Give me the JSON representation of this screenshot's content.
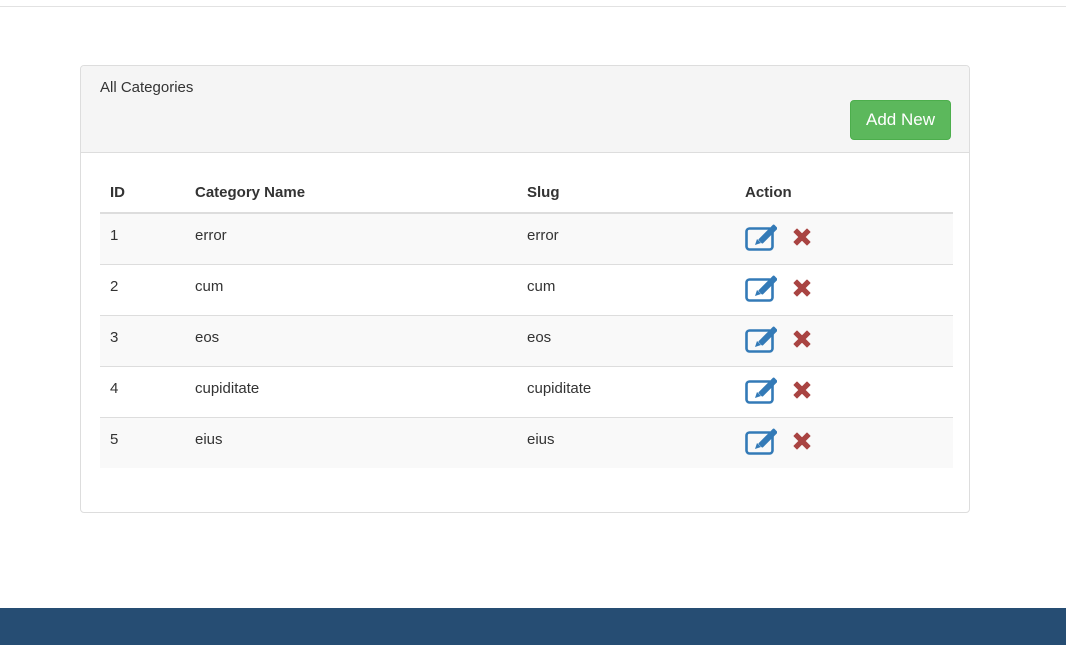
{
  "panel": {
    "title": "All Categories",
    "add_button_label": "Add New"
  },
  "table": {
    "headers": [
      "ID",
      "Category Name",
      "Slug",
      "Action"
    ],
    "rows": [
      {
        "id": "1",
        "name": "error",
        "slug": "error"
      },
      {
        "id": "2",
        "name": "cum",
        "slug": "cum"
      },
      {
        "id": "3",
        "name": "eos",
        "slug": "eos"
      },
      {
        "id": "4",
        "name": "cupiditate",
        "slug": "cupiditate"
      },
      {
        "id": "5",
        "name": "eius",
        "slug": "eius"
      }
    ]
  },
  "icons": {
    "edit": "edit-icon",
    "delete": "delete-icon"
  },
  "colors": {
    "add_button": "#5cb85c",
    "edit_icon": "#337ab7",
    "delete_icon": "#a94442",
    "footer": "#264d73"
  }
}
